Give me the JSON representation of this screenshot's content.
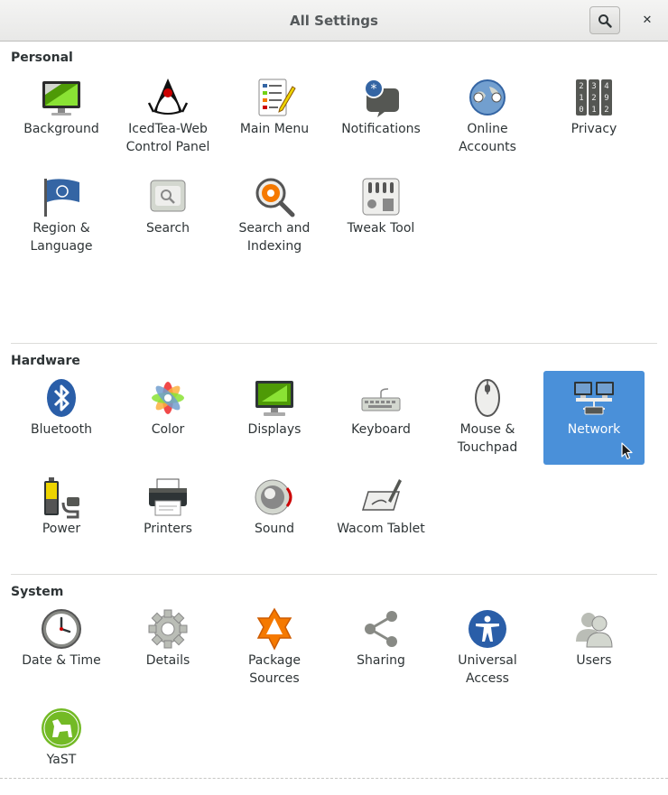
{
  "window": {
    "title": "All Settings",
    "search_icon": "search-icon",
    "close_icon": "close-icon",
    "close_glyph": "✕"
  },
  "sections": {
    "personal": {
      "title": "Personal",
      "items": [
        {
          "label": "Background",
          "icon": "background-icon"
        },
        {
          "label": "IcedTea-Web\nControl Panel",
          "icon": "java-duke-icon"
        },
        {
          "label": "Main Menu",
          "icon": "main-menu-icon"
        },
        {
          "label": "Notifications",
          "icon": "notifications-icon"
        },
        {
          "label": "Online\nAccounts",
          "icon": "online-accounts-icon"
        },
        {
          "label": "Privacy",
          "icon": "privacy-icon"
        },
        {
          "label": "Region &\nLanguage",
          "icon": "region-flag-icon"
        },
        {
          "label": "Search",
          "icon": "search-settings-icon"
        },
        {
          "label": "Search and\nIndexing",
          "icon": "search-indexing-icon"
        },
        {
          "label": "Tweak Tool",
          "icon": "tweak-tool-icon"
        }
      ]
    },
    "hardware": {
      "title": "Hardware",
      "items": [
        {
          "label": "Bluetooth",
          "icon": "bluetooth-icon"
        },
        {
          "label": "Color",
          "icon": "color-icon"
        },
        {
          "label": "Displays",
          "icon": "displays-icon"
        },
        {
          "label": "Keyboard",
          "icon": "keyboard-icon"
        },
        {
          "label": "Mouse &\nTouchpad",
          "icon": "mouse-icon"
        },
        {
          "label": "Network",
          "icon": "network-icon",
          "selected": true
        },
        {
          "label": "Power",
          "icon": "power-battery-icon"
        },
        {
          "label": "Printers",
          "icon": "printer-icon"
        },
        {
          "label": "Sound",
          "icon": "sound-speaker-icon"
        },
        {
          "label": "Wacom Tablet",
          "icon": "wacom-tablet-icon"
        }
      ]
    },
    "system": {
      "title": "System",
      "items": [
        {
          "label": "Date & Time",
          "icon": "clock-icon"
        },
        {
          "label": "Details",
          "icon": "gear-icon"
        },
        {
          "label": "Package\nSources",
          "icon": "package-sources-icon"
        },
        {
          "label": "Sharing",
          "icon": "share-icon"
        },
        {
          "label": "Universal\nAccess",
          "icon": "accessibility-icon"
        },
        {
          "label": "Users",
          "icon": "users-icon"
        },
        {
          "label": "YaST",
          "icon": "yast-icon"
        }
      ]
    }
  },
  "colors": {
    "selected_bg": "#4a90d9",
    "selected_text": "#ffffff",
    "text": "#2e3436"
  }
}
